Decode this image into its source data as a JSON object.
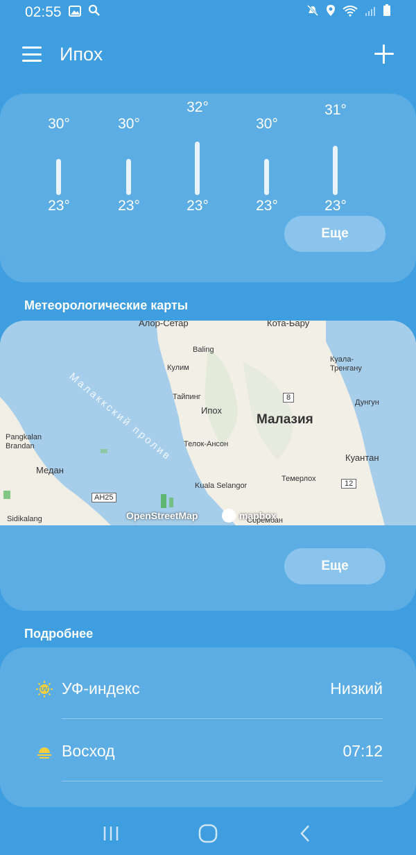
{
  "status": {
    "time": "02:55"
  },
  "header": {
    "title": "Ипох"
  },
  "forecast": {
    "days": [
      {
        "high": "30°",
        "low": "23°"
      },
      {
        "high": "30°",
        "low": "23°"
      },
      {
        "high": "32°",
        "low": "23°"
      },
      {
        "high": "30°",
        "low": "23°"
      },
      {
        "high": "31°",
        "low": "23°"
      }
    ],
    "more_label": "Еще"
  },
  "maps": {
    "title": "Метеорологические карты",
    "more_label": "Еще",
    "labels": {
      "alor_setar": "Алор-Сетар",
      "kota_bharu": "Кота-Бару",
      "baling": "Baling",
      "kulim": "Кулим",
      "kuala_terengganu": "Куала-Тренгану",
      "taiping": "Тайпинг",
      "ipoh": "Ипох",
      "malaysia": "Малазия",
      "dungun": "Дунгун",
      "pangkalan": "Pangkalan Brandan",
      "teluk_anson": "Телок-Ансон",
      "strait": "Малаккский пролив",
      "medan": "Медан",
      "kuantan": "Куантан",
      "temerloh": "Темерлох",
      "kuala_selangor": "Kuala Selangor",
      "sidikalang": "Sidikalang",
      "seremban": "Серембан",
      "road_8": "8",
      "road_12": "12",
      "road_ah25": "AH25"
    },
    "attribution": {
      "osm": "OpenStreetMap",
      "mapbox": "mapbox"
    }
  },
  "details": {
    "title": "Подробнее",
    "rows": [
      {
        "label": "УФ-индекс",
        "value": "Низкий",
        "icon": "uv-icon"
      },
      {
        "label": "Восход",
        "value": "07:12",
        "icon": "sunrise-icon"
      }
    ]
  },
  "colors": {
    "background": "#3f9ee0",
    "uv_icon": "#f6d040",
    "sun_icon": "#f6d040"
  }
}
